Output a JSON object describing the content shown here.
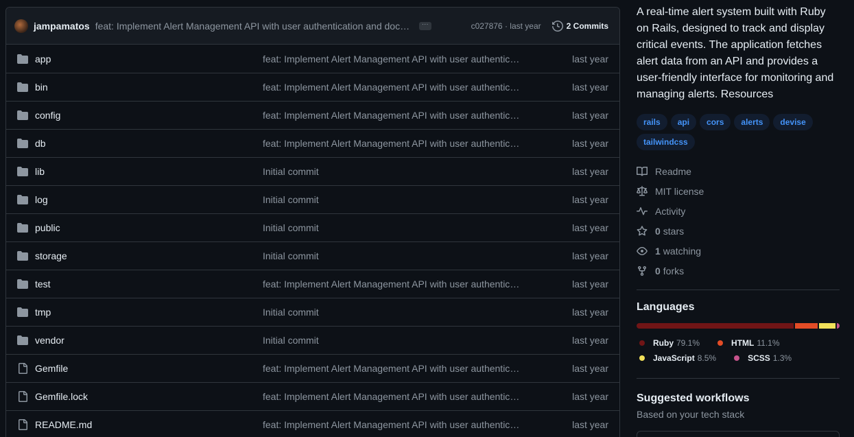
{
  "latest_commit": {
    "author": "jampamatos",
    "message": "feat: Implement Alert Management API with user authentication and doc…",
    "sha": "c027876",
    "age": "last year",
    "commits_label": "2 Commits"
  },
  "files": [
    {
      "name": "app",
      "type": "folder",
      "message": "feat: Implement Alert Management API with user authentica…",
      "age": "last year"
    },
    {
      "name": "bin",
      "type": "folder",
      "message": "feat: Implement Alert Management API with user authentica…",
      "age": "last year"
    },
    {
      "name": "config",
      "type": "folder",
      "message": "feat: Implement Alert Management API with user authentica…",
      "age": "last year"
    },
    {
      "name": "db",
      "type": "folder",
      "message": "feat: Implement Alert Management API with user authentica…",
      "age": "last year"
    },
    {
      "name": "lib",
      "type": "folder",
      "message": "Initial commit",
      "age": "last year"
    },
    {
      "name": "log",
      "type": "folder",
      "message": "Initial commit",
      "age": "last year"
    },
    {
      "name": "public",
      "type": "folder",
      "message": "Initial commit",
      "age": "last year"
    },
    {
      "name": "storage",
      "type": "folder",
      "message": "Initial commit",
      "age": "last year"
    },
    {
      "name": "test",
      "type": "folder",
      "message": "feat: Implement Alert Management API with user authentica…",
      "age": "last year"
    },
    {
      "name": "tmp",
      "type": "folder",
      "message": "Initial commit",
      "age": "last year"
    },
    {
      "name": "vendor",
      "type": "folder",
      "message": "Initial commit",
      "age": "last year"
    },
    {
      "name": "Gemfile",
      "type": "file",
      "message": "feat: Implement Alert Management API with user authentica…",
      "age": "last year"
    },
    {
      "name": "Gemfile.lock",
      "type": "file",
      "message": "feat: Implement Alert Management API with user authentica…",
      "age": "last year"
    },
    {
      "name": "README.md",
      "type": "file",
      "message": "feat: Implement Alert Management API with user authentica…",
      "age": "last year"
    }
  ],
  "about": {
    "description": "A real-time alert system built with Ruby on Rails, designed to track and display critical events. The application fetches alert data from an API and provides a user-friendly interface for monitoring and managing alerts. Resources",
    "topics": [
      "rails",
      "api",
      "cors",
      "alerts",
      "devise",
      "tailwindcss"
    ],
    "meta": [
      {
        "icon": "book-icon",
        "bold": "",
        "label": "Readme"
      },
      {
        "icon": "law-icon",
        "bold": "",
        "label": "MIT license"
      },
      {
        "icon": "pulse-icon",
        "bold": "",
        "label": "Activity"
      },
      {
        "icon": "star-icon",
        "bold": "0",
        "label": "stars"
      },
      {
        "icon": "eye-icon",
        "bold": "1",
        "label": "watching"
      },
      {
        "icon": "fork-icon",
        "bold": "0",
        "label": "forks"
      }
    ]
  },
  "languages": {
    "heading": "Languages",
    "items": [
      {
        "name": "Ruby",
        "percent": "79.1%",
        "value": 79.1,
        "color": "#701516"
      },
      {
        "name": "HTML",
        "percent": "11.1%",
        "value": 11.1,
        "color": "#e34c26"
      },
      {
        "name": "JavaScript",
        "percent": "8.5%",
        "value": 8.5,
        "color": "#f1e05a"
      },
      {
        "name": "SCSS",
        "percent": "1.3%",
        "value": 1.3,
        "color": "#c6538c"
      }
    ]
  },
  "workflows": {
    "heading": "Suggested workflows",
    "subtitle": "Based on your tech stack"
  }
}
